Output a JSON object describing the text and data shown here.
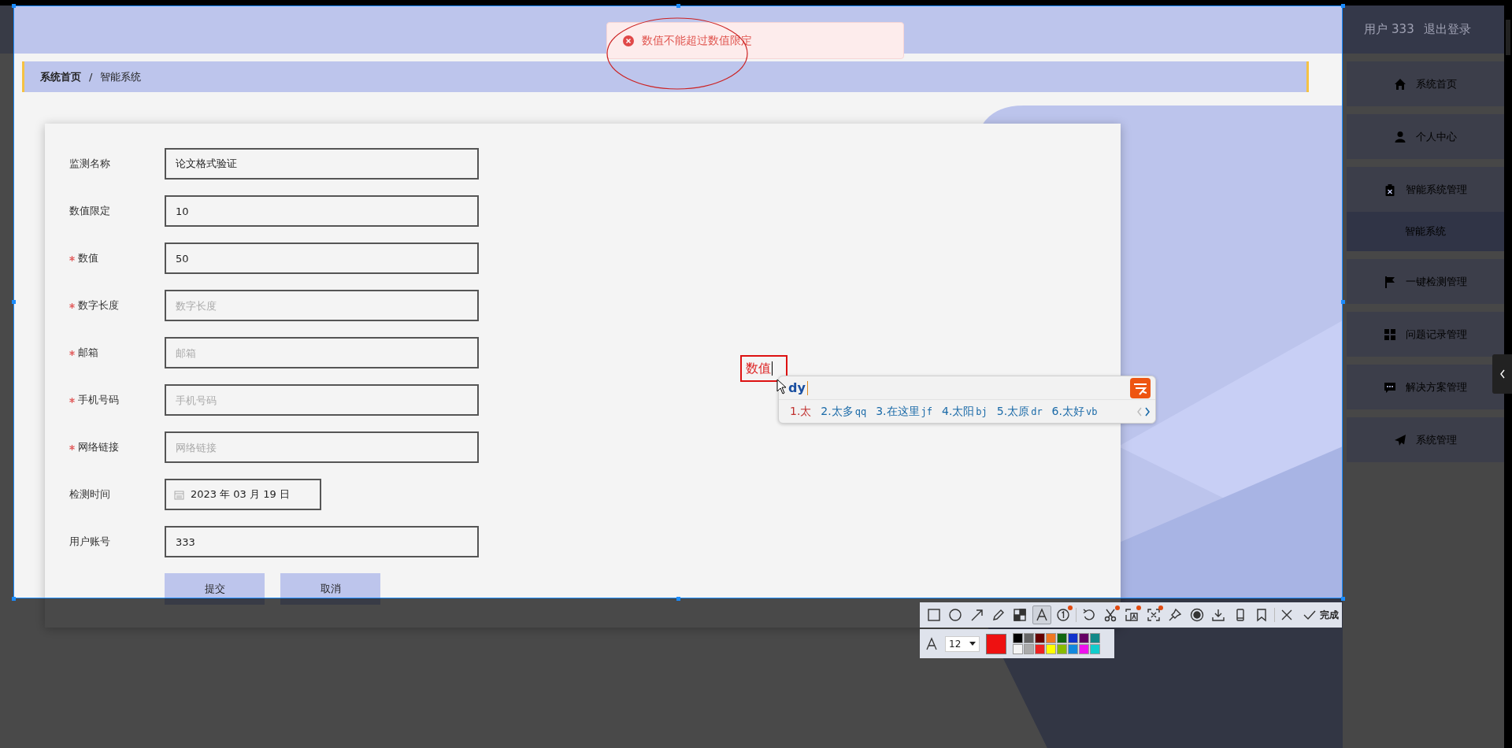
{
  "header": {
    "user_label": "用户 333",
    "logout": "退出登录"
  },
  "toast": {
    "message": "数值不能超过数值限定"
  },
  "breadcrumb": {
    "items": [
      "系统首页",
      "智能系统"
    ],
    "separator": "/"
  },
  "form": {
    "fields": [
      {
        "label": "监测名称",
        "required": false,
        "kind": "text",
        "value": "论文格式验证"
      },
      {
        "label": "数值限定",
        "required": false,
        "kind": "text",
        "value": "10"
      },
      {
        "label": "数值",
        "required": true,
        "kind": "text",
        "value": "50"
      },
      {
        "label": "数字长度",
        "required": true,
        "kind": "text",
        "placeholder": "数字长度"
      },
      {
        "label": "邮箱",
        "required": true,
        "kind": "text",
        "placeholder": "邮箱"
      },
      {
        "label": "手机号码",
        "required": true,
        "kind": "text",
        "placeholder": "手机号码"
      },
      {
        "label": "网络链接",
        "required": true,
        "kind": "text",
        "placeholder": "网络链接"
      },
      {
        "label": "检测时间",
        "required": false,
        "kind": "date",
        "value": "2023 年 03 月 19 日"
      },
      {
        "label": "用户账号",
        "required": false,
        "kind": "text",
        "value": "333"
      }
    ],
    "buttons": [
      "提交",
      "取消"
    ]
  },
  "sidebar": {
    "items": [
      {
        "label": "系统首页"
      },
      {
        "label": "个人中心"
      },
      {
        "label": "智能系统管理",
        "children": [
          {
            "label": "智能系统",
            "selected": true
          }
        ]
      },
      {
        "label": "一键检测管理"
      },
      {
        "label": "问题记录管理"
      },
      {
        "label": "解决方案管理"
      },
      {
        "label": "系统管理"
      }
    ]
  },
  "annotation": {
    "text": "数值"
  },
  "ime": {
    "composition": "dy",
    "candidates": [
      {
        "text": "1.太",
        "selected": true
      },
      {
        "text": "2.太多",
        "code": "qq",
        "selected": false
      },
      {
        "text": "3.在这里",
        "code": "jf",
        "selected": false
      },
      {
        "text": "4.太阳",
        "code": "bj",
        "selected": false
      },
      {
        "text": "5.太原",
        "code": "dr",
        "selected": false
      },
      {
        "text": "6.太好",
        "code": "vb",
        "selected": false
      }
    ]
  },
  "capture_toolbar": {
    "tools": [
      {
        "selected": false,
        "badge": false
      },
      {
        "selected": false,
        "badge": false
      },
      {
        "selected": false,
        "badge": false
      },
      {
        "selected": false,
        "badge": false
      },
      {
        "selected": false,
        "badge": false
      },
      {
        "selected": true,
        "badge": false
      },
      {
        "selected": false,
        "badge": true
      },
      {
        "selected": false,
        "badge": false
      },
      {
        "selected": false,
        "badge": true
      },
      {
        "selected": false,
        "badge": true
      },
      {
        "selected": false,
        "badge": true
      },
      {
        "selected": false,
        "badge": false
      },
      {
        "selected": false,
        "badge": false
      },
      {
        "selected": false,
        "badge": false
      },
      {
        "selected": false,
        "badge": false
      },
      {
        "selected": false,
        "badge": false
      }
    ],
    "done_label": "完成",
    "font_size": "12",
    "current": {
      "color": "#ee1111"
    },
    "palette": [
      {
        "color": "#000000"
      },
      {
        "color": "#666666"
      },
      {
        "color": "#660000"
      },
      {
        "color": "#ee7722"
      },
      {
        "color": "#116611"
      },
      {
        "color": "#1133cc"
      },
      {
        "color": "#660066"
      },
      {
        "color": "#118888"
      },
      {
        "color": "#f4f4f4"
      },
      {
        "color": "#aaaaaa"
      },
      {
        "color": "#ee2222"
      },
      {
        "color": "#ffff00"
      },
      {
        "color": "#88bb00"
      },
      {
        "color": "#1188dd"
      },
      {
        "color": "#ee11ee"
      },
      {
        "color": "#11cccc"
      }
    ]
  }
}
